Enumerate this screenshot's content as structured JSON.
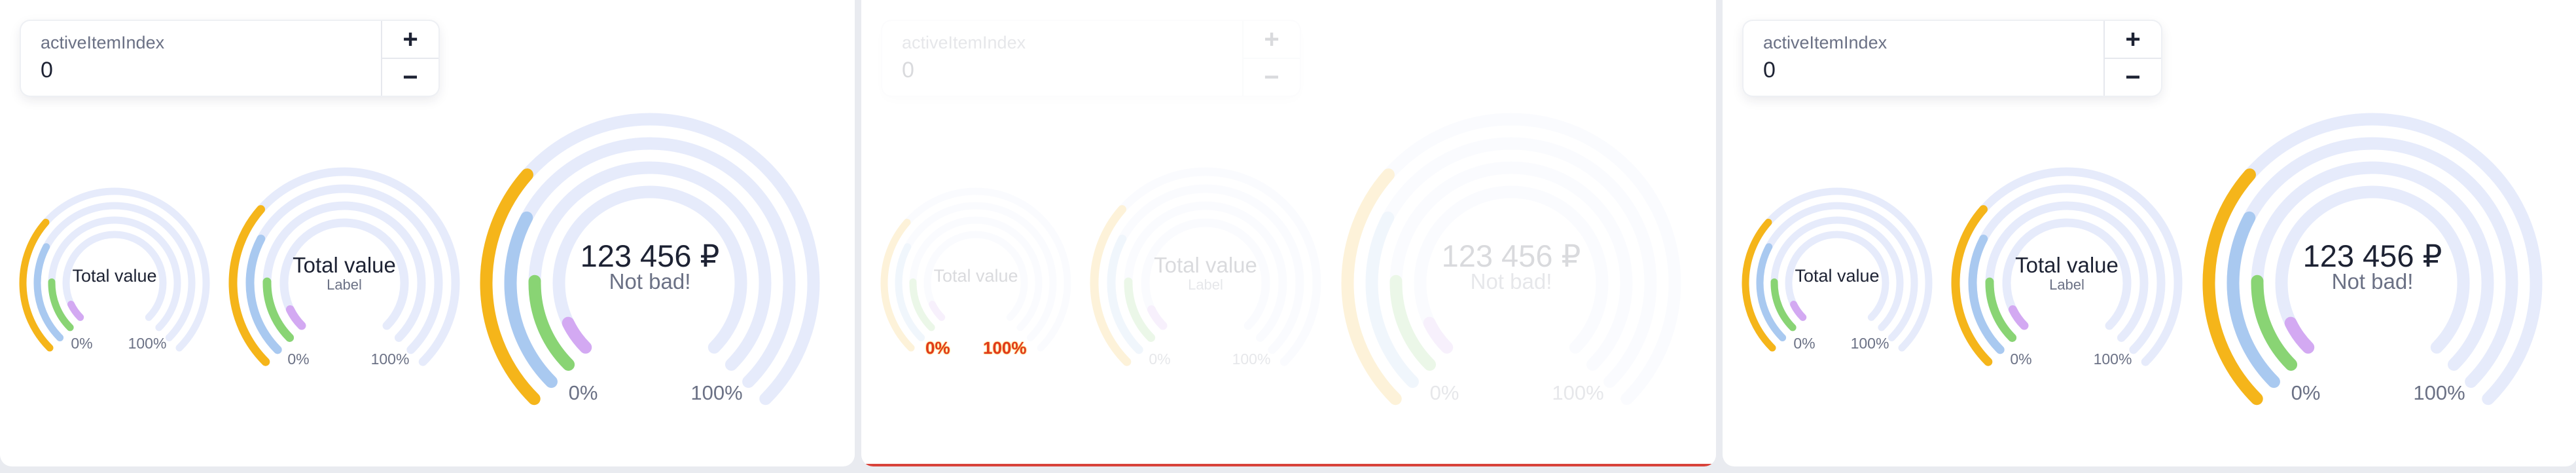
{
  "panels": [
    {
      "stepper": {
        "label": "activeItemIndex",
        "value": "0",
        "plus": "+",
        "minus": "−"
      },
      "gauges": [
        {
          "value": "Total value",
          "label": "",
          "min": "0%",
          "max": "100%"
        },
        {
          "value": "Total value",
          "label": "Label",
          "min": "0%",
          "max": "100%"
        },
        {
          "value": "123 456 ₽",
          "label": "Not bad!",
          "min": "0%",
          "max": "100%"
        }
      ]
    },
    {
      "stepper": {
        "label": "activeItemIndex",
        "value": "0",
        "plus": "+",
        "minus": "−"
      },
      "gauges": [
        {
          "value": "Total value",
          "label": "",
          "min": "0%",
          "max": "100%"
        },
        {
          "value": "Total value",
          "label": "Label",
          "min": "0%",
          "max": "100%"
        },
        {
          "value": "123 456 ₽",
          "label": "Not bad!",
          "min": "0%",
          "max": "100%"
        }
      ]
    },
    {
      "stepper": {
        "label": "activeItemIndex",
        "value": "0",
        "plus": "+",
        "minus": "−"
      },
      "gauges": [
        {
          "value": "Total value",
          "label": "",
          "min": "0%",
          "max": "100%"
        },
        {
          "value": "Total value",
          "label": "Label",
          "min": "0%",
          "max": "100%"
        },
        {
          "value": "123 456 ₽",
          "label": "Not bad!",
          "min": "0%",
          "max": "100%"
        }
      ]
    }
  ],
  "rings": [
    {
      "color": "#f5b51a",
      "fill": 0.32
    },
    {
      "color": "#a9c9f0",
      "fill": 0.27
    },
    {
      "color": "#89d474",
      "fill": 0.17
    },
    {
      "color": "#d3a9f2",
      "fill": 0.07
    }
  ],
  "track_color": "#e6ebfb",
  "active_index": 0
}
